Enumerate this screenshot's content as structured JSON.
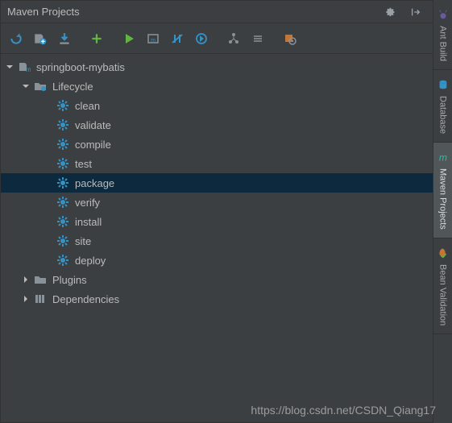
{
  "header": {
    "title": "Maven Projects"
  },
  "tree": {
    "root": {
      "label": "springboot-mybatis"
    },
    "lifecycle_label": "Lifecycle",
    "phases": [
      {
        "label": "clean"
      },
      {
        "label": "validate"
      },
      {
        "label": "compile"
      },
      {
        "label": "test"
      },
      {
        "label": "package",
        "selected": true
      },
      {
        "label": "verify"
      },
      {
        "label": "install"
      },
      {
        "label": "site"
      },
      {
        "label": "deploy"
      }
    ],
    "plugins_label": "Plugins",
    "dependencies_label": "Dependencies"
  },
  "sidetabs": {
    "ant": "Ant Build",
    "database": "Database",
    "maven": "Maven Projects",
    "bean": "Bean Validation"
  },
  "watermark": "https://blog.csdn.net/CSDN_Qiang17"
}
